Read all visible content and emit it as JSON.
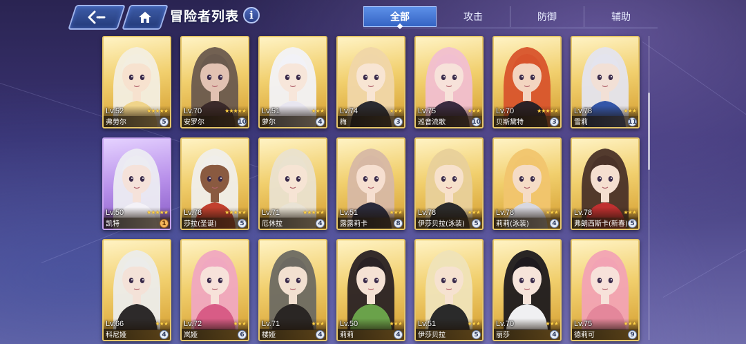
{
  "header": {
    "title": "冒险者列表",
    "back_icon": "back-arrow-icon",
    "home_icon": "home-icon",
    "info_icon": "info-icon",
    "info_glyph": "i"
  },
  "tabs": [
    {
      "label": "全部",
      "active": true
    },
    {
      "label": "攻击",
      "active": false
    },
    {
      "label": "防御",
      "active": false
    },
    {
      "label": "辅助",
      "active": false
    }
  ],
  "colors": {
    "gold_frame": "#e7c768",
    "purple_frame": "#c8a4f0",
    "star": "#ffd34a",
    "tab_active": "#3564c4"
  },
  "adventurers": [
    {
      "level": "Lv.52",
      "name": "弗劳尔",
      "stars": "★★★★★",
      "count": "5",
      "frame": "gold",
      "hair": "#f3eee0",
      "skin": "#f7e2cf",
      "outfit": "#f0d48a"
    },
    {
      "level": "Lv.70",
      "name": "安罗尔",
      "stars": "★★★★★",
      "count": "10",
      "frame": "gold",
      "hair": "#6a5a4e",
      "skin": "#e2c2b2",
      "outfit": "#3b2a2a"
    },
    {
      "level": "Lv.51",
      "name": "萝尔",
      "stars": "★★★",
      "count": "4",
      "frame": "gold",
      "hair": "#f2f2f7",
      "skin": "#f7e6da",
      "outfit": "#e8e6f0"
    },
    {
      "level": "Lv.74",
      "name": "梅",
      "stars": "★★★",
      "count": "3",
      "frame": "gold",
      "hair": "#f0d6a8",
      "skin": "#f8e5d3",
      "outfit": "#2b2b30"
    },
    {
      "level": "Lv.75",
      "name": "巡音流歌",
      "stars": "★★★",
      "count": "10",
      "frame": "gold",
      "hair": "#f1bfd0",
      "skin": "#f7e2da",
      "outfit": "#3a2b40"
    },
    {
      "level": "Lv.70",
      "name": "贝斯黛特",
      "stars": "★★★★★",
      "count": "3",
      "frame": "gold",
      "hair": "#d8542c",
      "skin": "#f3d5c0",
      "outfit": "#2b2226"
    },
    {
      "level": "Lv.78",
      "name": "雪莉",
      "stars": "★★★",
      "count": "11",
      "frame": "gold",
      "hair": "#e4e4ee",
      "skin": "#f2e0d6",
      "outfit": "#3456a8"
    },
    {
      "level": "Lv.50",
      "name": "凯特",
      "stars": "★★★★★",
      "count": "1",
      "frame": "purple",
      "badge": "orange",
      "hair": "#ececf2",
      "skin": "#f5e2da",
      "outfit": "#f4f2f8"
    },
    {
      "level": "Lv.78",
      "name": "莎拉(圣诞)",
      "stars": "★★★★★",
      "count": "5",
      "frame": "gold",
      "hair": "#f0eeea",
      "skin": "#8a5a40",
      "outfit": "#c2402e"
    },
    {
      "level": "Lv.71",
      "name": "厄休拉",
      "stars": "★★★★★",
      "count": "4",
      "frame": "gold",
      "hair": "#eae2cf",
      "skin": "#f6e4d4",
      "outfit": "#e9e3d5"
    },
    {
      "level": "Lv.51",
      "name": "露露莉卡",
      "stars": "★★★",
      "count": "8",
      "frame": "gold",
      "hair": "#d7b8a4",
      "skin": "#f6dfd0",
      "outfit": "#2a2a3a"
    },
    {
      "level": "Lv.78",
      "name": "伊莎贝拉(泳装)",
      "stars": "★★★",
      "count": "5",
      "frame": "gold",
      "hair": "#e8d09a",
      "skin": "#f7e1cb",
      "outfit": "#2b2b2b"
    },
    {
      "level": "Lv.78",
      "name": "莉莉(泳装)",
      "stars": "★★★",
      "count": "4",
      "frame": "gold",
      "hair": "#f1c56e",
      "skin": "#f5dcc6",
      "outfit": "#d8d8e0"
    },
    {
      "level": "Lv.78",
      "name": "弗朗西斯卡(新春)",
      "stars": "★★★",
      "count": "5",
      "frame": "gold",
      "hair": "#4a3228",
      "skin": "#f5dfd0",
      "outfit": "#c03030"
    },
    {
      "level": "Lv.66",
      "name": "科尼娅",
      "stars": "★★★",
      "count": "4",
      "frame": "gold",
      "hair": "#ececea",
      "skin": "#f4e2d8",
      "outfit": "#2d2a2a"
    },
    {
      "level": "Lv.72",
      "name": "岚娅",
      "stars": "★★★",
      "count": "6",
      "frame": "gold",
      "hair": "#f0a8c0",
      "skin": "#f7e2da",
      "outfit": "#d85c86"
    },
    {
      "level": "Lv.71",
      "name": "楼娅",
      "stars": "★★★",
      "count": "4",
      "frame": "gold",
      "hair": "#6d6a62",
      "skin": "#f2e0d0",
      "outfit": "#2a2624"
    },
    {
      "level": "Lv.50",
      "name": "莉莉",
      "stars": "★★★",
      "count": "4",
      "frame": "gold",
      "hair": "#2a2224",
      "skin": "#f5e2d4",
      "outfit": "#6aa24a"
    },
    {
      "level": "Lv.51",
      "name": "伊莎贝拉",
      "stars": "★★★",
      "count": "5",
      "frame": "gold",
      "hair": "#efe3b8",
      "skin": "#f6e2d0",
      "outfit": "#2a2a2a"
    },
    {
      "level": "Lv.70",
      "name": "丽莎",
      "stars": "★★★",
      "count": "4",
      "frame": "gold",
      "hair": "#1e1a1e",
      "skin": "#f6e4da",
      "outfit": "#f0f0f2"
    },
    {
      "level": "Lv.75",
      "name": "德莉可",
      "stars": "★★★",
      "count": "9",
      "frame": "gold",
      "hair": "#f2a3b4",
      "skin": "#f7e2da",
      "outfit": "#e4879b"
    }
  ]
}
